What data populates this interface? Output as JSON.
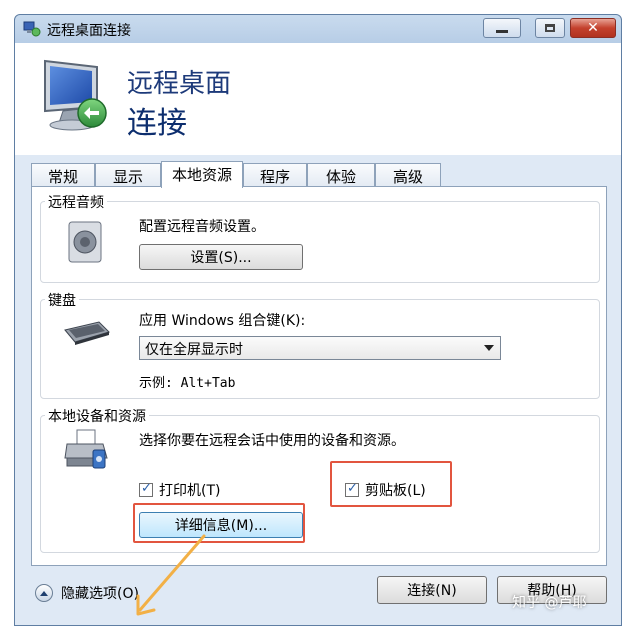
{
  "window": {
    "title": "远程桌面连接"
  },
  "header": {
    "line1": "远程桌面",
    "line2": "连接"
  },
  "tabs": [
    {
      "label": "常规"
    },
    {
      "label": "显示"
    },
    {
      "label": "本地资源"
    },
    {
      "label": "程序"
    },
    {
      "label": "体验"
    },
    {
      "label": "高级"
    }
  ],
  "active_tab": "本地资源",
  "audio": {
    "title": "远程音频",
    "description": "配置远程音频设置。",
    "settings_button": "设置(S)..."
  },
  "keyboard": {
    "title": "键盘",
    "description": "应用 Windows 组合键(K):",
    "selected_option": "仅在全屏显示时",
    "example": "示例: Alt+Tab"
  },
  "devices": {
    "title": "本地设备和资源",
    "description": "选择你要在远程会话中使用的设备和资源。",
    "printer_label": "打印机(T)",
    "printer_checked": true,
    "clipboard_label": "剪贴板(L)",
    "clipboard_checked": true,
    "details_button": "详细信息(M)..."
  },
  "footer": {
    "hide_options": "隐藏选项(O)",
    "connect_button": "连接(N)",
    "help_button": "帮助(H)"
  },
  "watermark": "知乎 @芦耶",
  "colors": {
    "highlight": "#e2553f",
    "arrow": "#f2b046",
    "title_text": "#1d3a7a"
  }
}
